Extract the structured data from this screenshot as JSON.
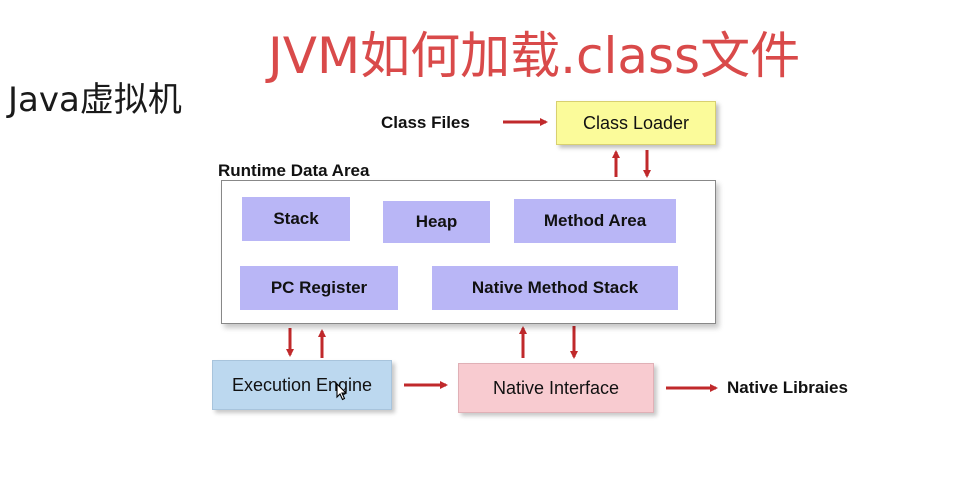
{
  "slide_title": "JVM如何加载.class文件",
  "side_title": "Java虚拟机",
  "diagram": {
    "class_files": "Class Files",
    "class_loader": "Class Loader",
    "runtime_data_area": "Runtime Data Area",
    "stack": "Stack",
    "heap": "Heap",
    "method_area": "Method Area",
    "pc_register": "PC Register",
    "native_method_stack": "Native Method Stack",
    "execution_engine": "Execution Engine",
    "native_interface": "Native Interface",
    "native_libraries": "Native Libraies"
  },
  "colors": {
    "title_red": "#d94a4a",
    "arrow_red": "#c0292b",
    "class_loader_yellow": "#fbfb9a",
    "memory_purple": "#b9b6f6",
    "engine_blue": "#bcd8ef",
    "interface_pink": "#f8cbd0"
  }
}
